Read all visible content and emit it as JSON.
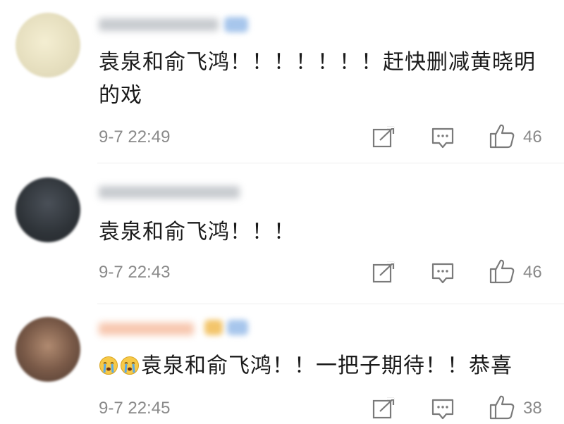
{
  "comments": [
    {
      "text": "袁泉和俞飞鸿！！！！！！！赶快删减黄晓明的戏",
      "time": "9-7 22:49",
      "likes": "46",
      "avatar_color": "#e9e3c8",
      "badge_color": "#a7c6ec"
    },
    {
      "text": "袁泉和俞飞鸿！！！",
      "time": "9-7 22:43",
      "likes": "46",
      "avatar_color": "#3a3f45"
    },
    {
      "emoji": [
        "crying-face-icon",
        "crying-face-icon"
      ],
      "text": "袁泉和俞飞鸿！！一把子期待！！恭喜",
      "time": "9-7 22:45",
      "likes": "38",
      "avatar_color": "#7a5a48",
      "badge_color": "#f3c56b"
    }
  ],
  "icons": {
    "share": "share-icon",
    "comment": "comment-icon",
    "like": "thumbs-up-icon"
  }
}
